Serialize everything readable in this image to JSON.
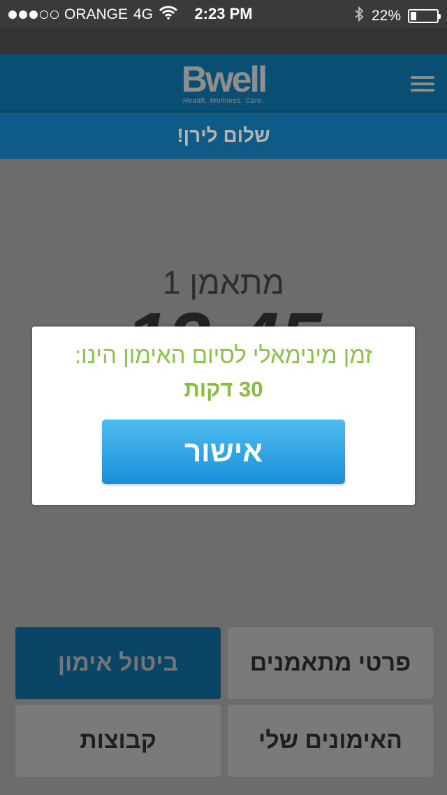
{
  "status_bar": {
    "carrier": "ORANGE",
    "network": "4G",
    "time": "2:23 PM",
    "battery_text": "22%",
    "battery_level": 0.22,
    "signal_bars": 3,
    "signal_total": 5,
    "icons": [
      "wifi-icon",
      "bluetooth-icon",
      "battery-icon"
    ]
  },
  "header": {
    "logo_text": "Bwell",
    "logo_tagline": "Health. Wellness. Care.",
    "menu_icon": "hamburger-menu-icon"
  },
  "greeting": "שלום לירן!",
  "main": {
    "trainee_label": "מתאמן 1",
    "time_display": "13:45"
  },
  "buttons": {
    "trainee_details": "פרטי מתאמנים",
    "cancel_workout": "ביטול אימון",
    "my_workouts": "האימונים שלי",
    "groups": "קבוצות"
  },
  "modal": {
    "message": "זמן מינימאלי לסיום האימון הינו:",
    "duration": "30 דקות",
    "confirm_label": "אישור"
  },
  "colors": {
    "header_bg": "#0a4e73",
    "modal_text": "#8bc34a",
    "confirm_button": "#2a9fe3",
    "primary_button": "#0a4566"
  }
}
